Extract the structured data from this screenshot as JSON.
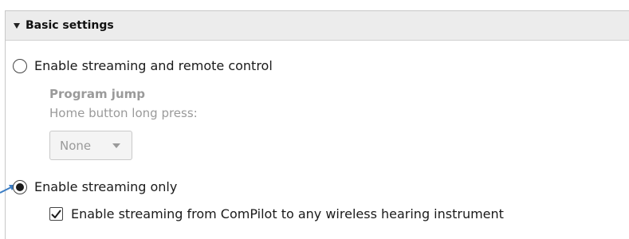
{
  "panel": {
    "title": "Basic settings",
    "toggle_icon": "triangle-down-icon"
  },
  "options": {
    "streaming_remote": {
      "label": "Enable streaming and remote control",
      "selected": false
    },
    "program_jump": {
      "heading": "Program jump",
      "home_button_label": "Home button long press:",
      "select_value": "None"
    },
    "streaming_only": {
      "label": "Enable streaming only",
      "selected": true
    },
    "compilot_checkbox": {
      "label": "Enable streaming from ComPilot to any wireless hearing instrument",
      "checked": true
    }
  },
  "colors": {
    "header_bg": "#ececec",
    "disabled_text": "#9a9a9a",
    "pointer_arrow": "#3b7dc4"
  }
}
